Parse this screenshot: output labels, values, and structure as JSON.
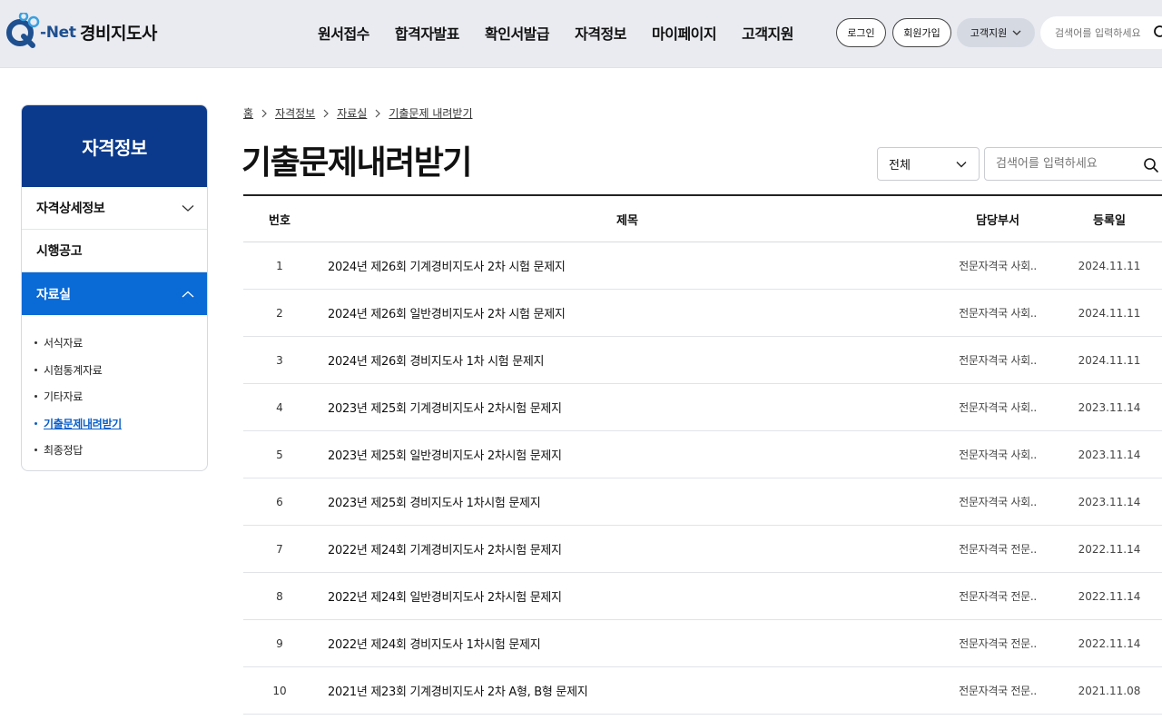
{
  "header": {
    "logo_net": "-Net",
    "site_title": "경비지도사",
    "nav": [
      "원서접수",
      "합격자발표",
      "확인서발급",
      "자격정보",
      "마이페이지",
      "고객지원"
    ],
    "login_label": "로그인",
    "join_label": "회원가입",
    "support_label": "고객지원",
    "search_placeholder": "검색어를 입력하세요"
  },
  "sidebar": {
    "title": "자격정보",
    "items": [
      {
        "label": "자격상세정보"
      },
      {
        "label": "시행공고"
      },
      {
        "label": "자료실"
      }
    ],
    "sub_items": [
      "서식자료",
      "시험통계자료",
      "기타자료",
      "기출문제내려받기",
      "최종정답"
    ]
  },
  "breadcrumb": [
    "홈",
    "자격정보",
    "자료실",
    "기출문제 내려받기"
  ],
  "page_title": "기출문제내려받기",
  "filter": {
    "selected": "전체",
    "search_placeholder": "검색어를 입력하세요"
  },
  "table": {
    "headers": {
      "no": "번호",
      "title": "제목",
      "dept": "담당부서",
      "date": "등록일"
    },
    "rows": [
      {
        "no": "1",
        "title": "2024년 제26회 기계경비지도사 2차 시험 문제지",
        "dept": "전문자격국 사회..",
        "date": "2024.11.11"
      },
      {
        "no": "2",
        "title": "2024년 제26회 일반경비지도사 2차 시험 문제지",
        "dept": "전문자격국 사회..",
        "date": "2024.11.11"
      },
      {
        "no": "3",
        "title": "2024년 제26회 경비지도사 1차 시험 문제지",
        "dept": "전문자격국 사회..",
        "date": "2024.11.11"
      },
      {
        "no": "4",
        "title": "2023년 제25회 기계경비지도사 2차시험 문제지",
        "dept": "전문자격국 사회..",
        "date": "2023.11.14"
      },
      {
        "no": "5",
        "title": "2023년 제25회 일반경비지도사 2차시험 문제지",
        "dept": "전문자격국 사회..",
        "date": "2023.11.14"
      },
      {
        "no": "6",
        "title": "2023년 제25회 경비지도사 1차시험 문제지",
        "dept": "전문자격국 사회..",
        "date": "2023.11.14"
      },
      {
        "no": "7",
        "title": "2022년 제24회 기계경비지도사 2차시험 문제지",
        "dept": "전문자격국 전문..",
        "date": "2022.11.14"
      },
      {
        "no": "8",
        "title": "2022년 제24회 일반경비지도사 2차시험 문제지",
        "dept": "전문자격국 전문..",
        "date": "2022.11.14"
      },
      {
        "no": "9",
        "title": "2022년 제24회 경비지도사 1차시험 문제지",
        "dept": "전문자격국 전문..",
        "date": "2022.11.14"
      },
      {
        "no": "10",
        "title": "2021년 제23회 기계경비지도사 2차 A형, B형 문제지",
        "dept": "전문자격국 전문..",
        "date": "2021.11.08"
      }
    ]
  },
  "colors": {
    "brand_navy": "#0b3a8c",
    "active_blue": "#0a6ad6",
    "header_bg": "#e9ebf1"
  }
}
